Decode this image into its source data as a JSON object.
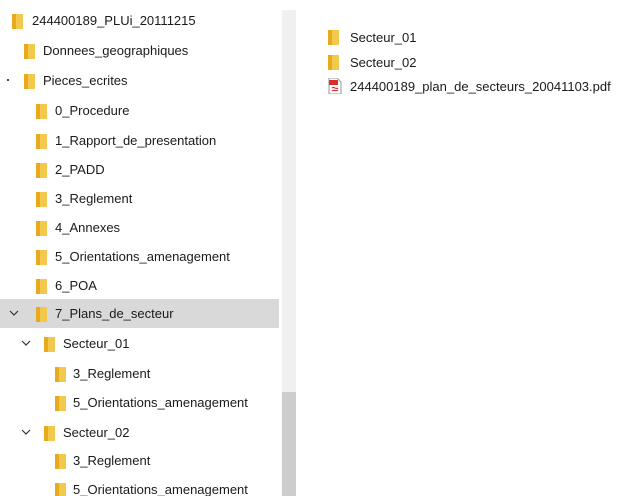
{
  "tree": {
    "items": [
      {
        "label": "244400189_PLUi_20111215",
        "icon": "folder-icon",
        "expander": "none"
      },
      {
        "label": "Donnees_geographiques",
        "icon": "folder-icon",
        "expander": "none"
      },
      {
        "label": "Pieces_ecrites",
        "icon": "folder-icon",
        "expander": "dot"
      },
      {
        "label": "0_Procedure",
        "icon": "folder-icon",
        "expander": "none"
      },
      {
        "label": "1_Rapport_de_presentation",
        "icon": "folder-icon",
        "expander": "none"
      },
      {
        "label": "2_PADD",
        "icon": "folder-icon",
        "expander": "none"
      },
      {
        "label": "3_Reglement",
        "icon": "folder-icon",
        "expander": "none"
      },
      {
        "label": "4_Annexes",
        "icon": "folder-icon",
        "expander": "none"
      },
      {
        "label": "5_Orientations_amenagement",
        "icon": "folder-icon",
        "expander": "none"
      },
      {
        "label": "6_POA",
        "icon": "folder-icon",
        "expander": "none"
      },
      {
        "label": "7_Plans_de_secteur",
        "icon": "folder-icon",
        "expander": "chevron-down",
        "selected": true
      },
      {
        "label": "Secteur_01",
        "icon": "folder-icon",
        "expander": "chevron-down"
      },
      {
        "label": "3_Reglement",
        "icon": "folder-icon",
        "expander": "none"
      },
      {
        "label": "5_Orientations_amenagement",
        "icon": "folder-icon",
        "expander": "none"
      },
      {
        "label": "Secteur_02",
        "icon": "folder-icon",
        "expander": "chevron-down"
      },
      {
        "label": "3_Reglement",
        "icon": "folder-icon",
        "expander": "none"
      },
      {
        "label": "5_Orientations_amenagement",
        "icon": "folder-icon",
        "expander": "none"
      }
    ]
  },
  "content": {
    "files": [
      {
        "label": "Secteur_01",
        "icon": "folder-icon"
      },
      {
        "label": "Secteur_02",
        "icon": "folder-icon"
      },
      {
        "label": "244400189_plan_de_secteurs_20041103.pdf",
        "icon": "pdf-file-icon"
      }
    ]
  },
  "colors": {
    "selection": "#d9d9d9",
    "folder_body": "#f2c94c",
    "folder_tab": "#e8a91d",
    "pdf_accent": "#d93025"
  }
}
